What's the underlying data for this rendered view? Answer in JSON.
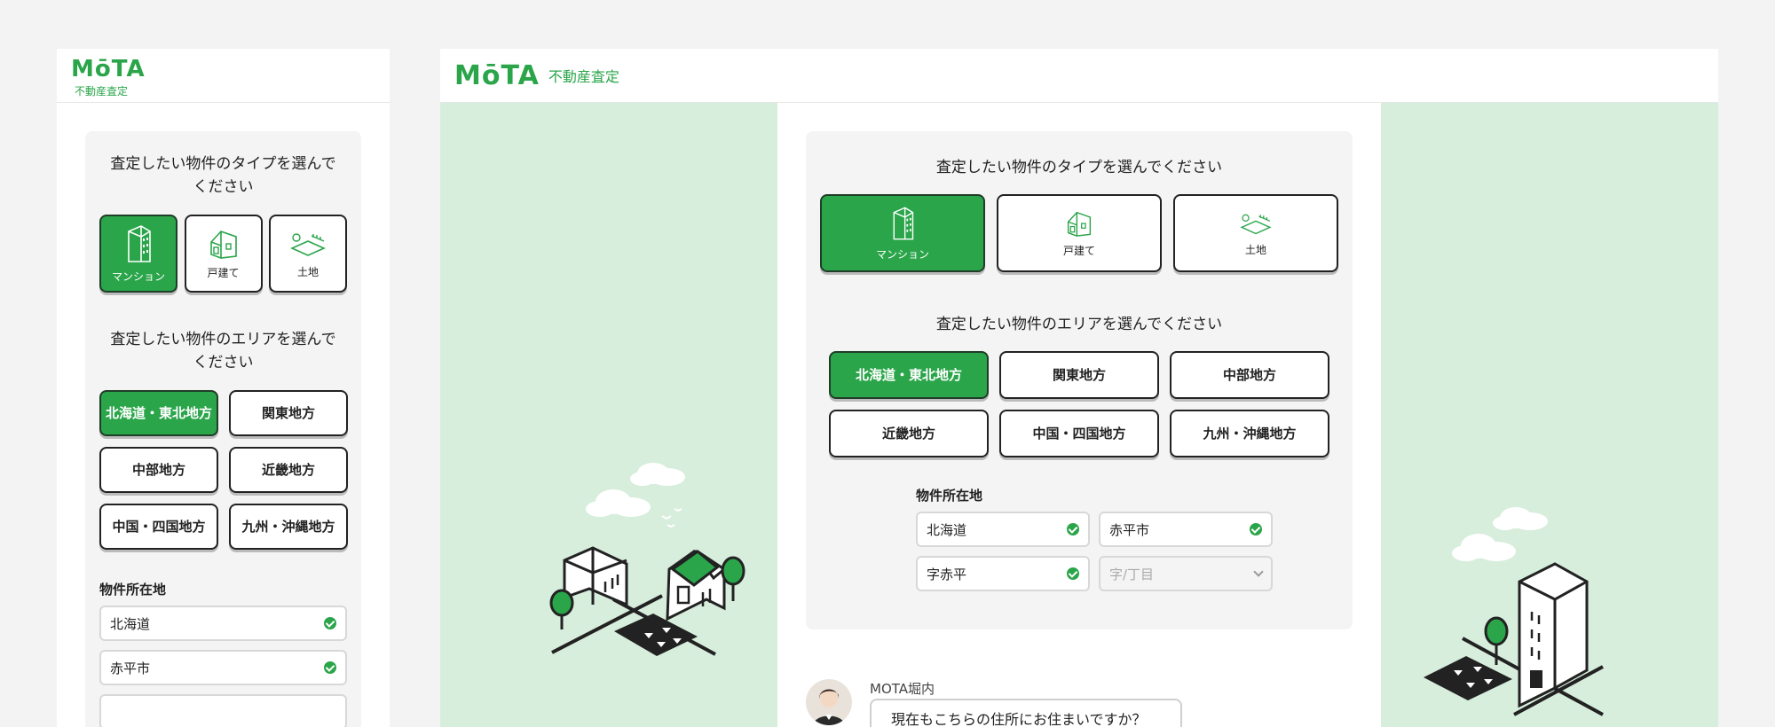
{
  "brand": {
    "logo": "MōTA",
    "subtitle": "不動産査定",
    "color": "#2aa54a"
  },
  "mobile": {
    "type_question": "査定したい物件のタイプを選んでください",
    "types": [
      {
        "label": "マンション",
        "icon": "apartment-icon",
        "selected": true
      },
      {
        "label": "戸建て",
        "icon": "house-icon",
        "selected": false
      },
      {
        "label": "土地",
        "icon": "land-icon",
        "selected": false
      }
    ],
    "area_question": "査定したい物件のエリアを選んでください",
    "areas": [
      "北海道・東北地方",
      "関東地方",
      "中部地方",
      "近畿地方",
      "中国・四国地方",
      "九州・沖縄地方"
    ],
    "selected_area": "北海道・東北地方",
    "location_title": "物件所在地",
    "fields": [
      {
        "value": "北海道",
        "checked": true
      },
      {
        "value": "赤平市",
        "checked": true
      }
    ]
  },
  "desktop": {
    "type_question": "査定したい物件のタイプを選んでください",
    "types": [
      {
        "label": "マンション",
        "icon": "apartment-icon",
        "selected": true
      },
      {
        "label": "戸建て",
        "icon": "house-icon",
        "selected": false
      },
      {
        "label": "土地",
        "icon": "land-icon",
        "selected": false
      }
    ],
    "area_question": "査定したい物件のエリアを選んでください",
    "areas": [
      "北海道・東北地方",
      "関東地方",
      "中部地方",
      "近畿地方",
      "中国・四国地方",
      "九州・沖縄地方"
    ],
    "selected_area": "北海道・東北地方",
    "location_title": "物件所在地",
    "fields": [
      {
        "value": "北海道",
        "checked": true,
        "disabled": false
      },
      {
        "value": "赤平市",
        "checked": true,
        "disabled": false
      },
      {
        "value": "字赤平",
        "checked": true,
        "disabled": false
      },
      {
        "value": "字/丁目",
        "checked": false,
        "disabled": true
      }
    ],
    "chat": {
      "name": "MOTA堀内",
      "message": "現在もこちらの住所にお住まいですか？"
    }
  }
}
